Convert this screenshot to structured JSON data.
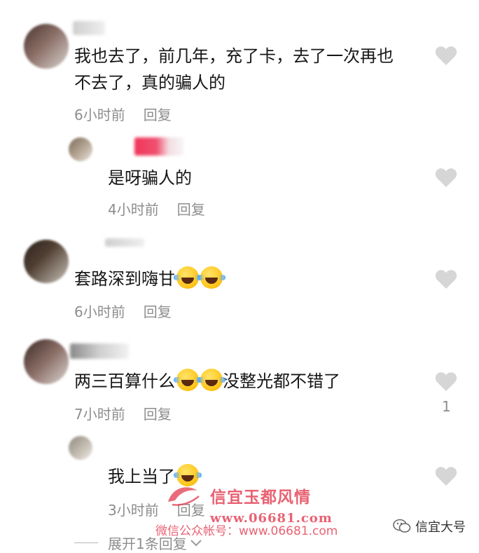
{
  "comments": [
    {
      "text_line1": "我也去了，前几年，充了卡，去了一次再也",
      "text_line2": "不去了，真的骗人的",
      "time": "6小时前",
      "reply": "回复"
    },
    {
      "text": "是呀骗人的",
      "time": "4小时前",
      "reply": "回复"
    },
    {
      "text": "套路深到嗨甘",
      "time": "6小时前",
      "reply": "回复"
    },
    {
      "text_a": "两三百算什么",
      "text_b": "没整光都不错了",
      "time": "7小时前",
      "reply": "回复",
      "likes": "1"
    },
    {
      "text": "我上当了",
      "time": "3小时前",
      "reply": "回复"
    }
  ],
  "expand_label": "展开1条回复",
  "watermark": {
    "title": "信宜玉都风情",
    "url": "www.06681.com",
    "line2": "微信公众帐号：www.06681.com"
  },
  "brand": "信宜大号",
  "colors": {
    "like_icon": "#d6d6d6",
    "watermark": "#e4475a",
    "meta": "#8d8d8d"
  }
}
